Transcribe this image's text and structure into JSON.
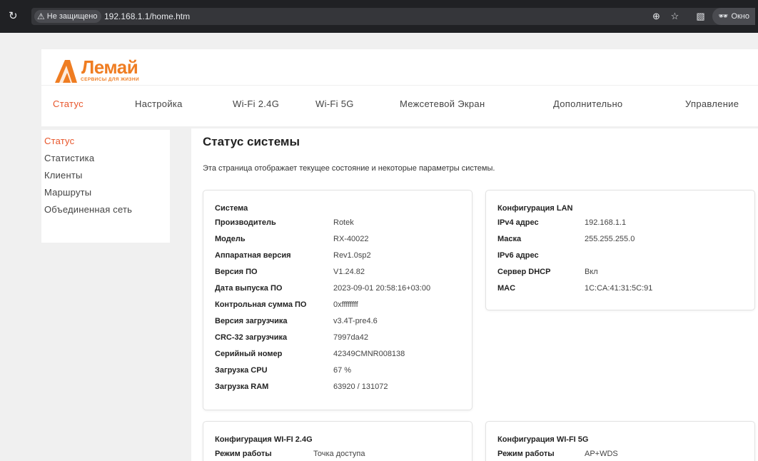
{
  "browser": {
    "security_label": "Не защищено",
    "url": "192.168.1.1/home.htm",
    "incognito_label": "Окно"
  },
  "brand": {
    "name": "Лемай",
    "tagline": "СЕРВИСЫ ДЛЯ ЖИЗНИ",
    "color": "#ef7d22"
  },
  "accent_color": "#e8552a",
  "nav": {
    "items": [
      {
        "label": "Статус"
      },
      {
        "label": "Настройка"
      },
      {
        "label": "Wi-Fi 2.4G"
      },
      {
        "label": "Wi-Fi 5G"
      },
      {
        "label": "Межсетевой Экран"
      },
      {
        "label": "Дополнительно"
      },
      {
        "label": "Управление"
      }
    ],
    "active": "Статус"
  },
  "sidebar": {
    "items": [
      {
        "label": "Статус"
      },
      {
        "label": "Статистика"
      },
      {
        "label": "Клиенты"
      },
      {
        "label": "Маршруты"
      },
      {
        "label": "Объединенная сеть"
      }
    ],
    "active": "Статус"
  },
  "main": {
    "title": "Статус системы",
    "description": "Эта страница отображает текущее состояние и некоторые параметры системы.",
    "system": {
      "title": "Система",
      "rows": [
        {
          "key": "Производитель",
          "value": "Rotek"
        },
        {
          "key": "Модель",
          "value": "RX-40022"
        },
        {
          "key": "Аппаратная версия",
          "value": "Rev1.0sp2"
        },
        {
          "key": "Версия ПО",
          "value": "V1.24.82"
        },
        {
          "key": "Дата выпуска ПО",
          "value": "2023-09-01 20:58:16+03:00"
        },
        {
          "key": "Контрольная сумма ПО",
          "value": "0xffffffff"
        },
        {
          "key": "Версия загрузчика",
          "value": "v3.4T-pre4.6"
        },
        {
          "key": "CRC-32 загрузчика",
          "value": "7997da42"
        },
        {
          "key": "Серийный номер",
          "value": "42349CMNR008138"
        },
        {
          "key": "Загрузка CPU",
          "value": "67 %"
        },
        {
          "key": "Загрузка RAM",
          "value": "63920 / 131072"
        }
      ]
    },
    "lan": {
      "title": "Конфигурация LAN",
      "rows": [
        {
          "key": "IPv4 адрес",
          "value": "192.168.1.1"
        },
        {
          "key": "Маска",
          "value": "255.255.255.0"
        },
        {
          "key": "IPv6 адрес",
          "value": ""
        },
        {
          "key": "Сервер DHCP",
          "value": "Вкл"
        },
        {
          "key": "MAC",
          "value": "1C:CA:41:31:5C:91"
        }
      ]
    },
    "wifi24": {
      "title": "Конфигурация WI-FI 2.4G",
      "rows": [
        {
          "key": "Режим работы",
          "value": "Точка доступа"
        }
      ]
    },
    "wifi5": {
      "title": "Конфигурация WI-FI 5G",
      "rows": [
        {
          "key": "Режим работы",
          "value": "AP+WDS"
        }
      ]
    }
  }
}
